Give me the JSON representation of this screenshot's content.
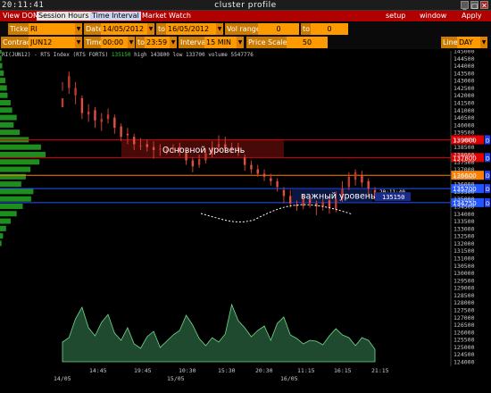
{
  "window": {
    "clock": "20:11:41",
    "title": "cluster profile",
    "buttons": [
      "_",
      "▢",
      "✕"
    ]
  },
  "menu": {
    "tabs": [
      "View DOM",
      "Session Hours",
      "Time Interval",
      "Market Watch"
    ],
    "right": [
      "setup",
      "window",
      "Apply"
    ]
  },
  "controls": {
    "ticker_label": "Ticker",
    "ticker": "RI",
    "date_label": "Date",
    "date_from": "14/05/2012",
    "to1": "to",
    "date_to": "16/05/2012",
    "vol_range_label": "Vol range",
    "vol_min": "0",
    "to2": "to",
    "vol_max": "0",
    "contract_label": "Contract",
    "contract": "JUN12",
    "time_label": "Time",
    "time_from": "00:00",
    "to3": "to",
    "time_to": "23:59",
    "interval_label": "Interval",
    "interval": "15 MIN",
    "price_scale_label": "Price Scale",
    "price_scale": "50",
    "line_label": "Line",
    "line": "DAY"
  },
  "info": {
    "symbol": "RI(JUN12) - RTS Index (RTS FORTS)",
    "last": "135150",
    "stats": "high 143800  low 133700  volume 5547776"
  },
  "chart_data": {
    "type": "candlestick",
    "y_ticks": [
      "145000",
      "144500",
      "144000",
      "143500",
      "143000",
      "142500",
      "142000",
      "141500",
      "141000",
      "140500",
      "140000",
      "139500",
      "139000",
      "138500",
      "138000",
      "137500",
      "137000",
      "136500",
      "136000",
      "135500",
      "135000",
      "134500",
      "134000",
      "133500",
      "133000",
      "132500",
      "132000",
      "131500",
      "131000",
      "130500",
      "130000",
      "129500",
      "129000",
      "128500",
      "128000",
      "127500",
      "127000",
      "126500",
      "126000",
      "125500",
      "125000",
      "124500",
      "124000"
    ],
    "x_ticks": [
      "14:45",
      "19:45",
      "10:30",
      "15:30",
      "20:30",
      "11:15",
      "16:15",
      "21:15"
    ],
    "dates": [
      "14/05",
      "15/05",
      "16/05"
    ],
    "levels": [
      {
        "price": "139000",
        "color": "#e00000"
      },
      {
        "price": "137800",
        "color": "#e00000"
      },
      {
        "price": "136600",
        "color": "#ff8000"
      },
      {
        "price": "135700",
        "color": "#2255ff"
      },
      {
        "price": "134750",
        "color": "#2255ff"
      }
    ],
    "level_tag": "D",
    "annotations": [
      "Основной уровень",
      "важный уровень"
    ],
    "cursor_time": "20:11:40",
    "current_price": "135150",
    "candles": [
      [
        40,
        141200,
        141800,
        142900,
        142300
      ],
      [
        44,
        142500,
        143300,
        143600,
        142100
      ],
      [
        48,
        142000,
        142500,
        142900,
        141400
      ],
      [
        52,
        141800,
        140800,
        142000,
        140400
      ],
      [
        56,
        140700,
        140900,
        141400,
        140200
      ],
      [
        60,
        141000,
        140300,
        141200,
        139800
      ],
      [
        64,
        140200,
        140400,
        140800,
        139600
      ],
      [
        68,
        140400,
        140700,
        141100,
        140100
      ],
      [
        72,
        140500,
        139800,
        140700,
        139400
      ],
      [
        76,
        139900,
        139200,
        140100,
        138900
      ],
      [
        80,
        139400,
        139300,
        139800,
        138700
      ],
      [
        84,
        139200,
        138700,
        139400,
        138300
      ],
      [
        88,
        138600,
        138600,
        139100,
        138300
      ],
      [
        92,
        138700,
        138500,
        139000,
        138200
      ],
      [
        96,
        138500,
        138300,
        138900,
        137700
      ],
      [
        100,
        138400,
        138400,
        138700,
        137900
      ],
      [
        104,
        138300,
        138300,
        138500,
        138000
      ],
      [
        108,
        138300,
        138400,
        138700,
        138100
      ],
      [
        112,
        138500,
        138200,
        138800,
        137900
      ],
      [
        116,
        138100,
        137600,
        138300,
        137300
      ],
      [
        120,
        137600,
        137200,
        137800,
        136800
      ],
      [
        124,
        137300,
        137700,
        138000,
        137100
      ],
      [
        128,
        137600,
        138100,
        138400,
        137400
      ],
      [
        132,
        138000,
        138500,
        138900,
        137800
      ],
      [
        136,
        138500,
        138700,
        139300,
        138200
      ],
      [
        140,
        138700,
        138400,
        139200,
        138200
      ],
      [
        144,
        138400,
        138500,
        138800,
        138100
      ],
      [
        148,
        138500,
        138300,
        138800,
        137900
      ],
      [
        152,
        137800,
        137300,
        138000,
        136900
      ],
      [
        156,
        137300,
        137000,
        137600,
        136700
      ],
      [
        160,
        137000,
        136700,
        137300,
        136500
      ],
      [
        164,
        136700,
        136500,
        137000,
        136200
      ],
      [
        168,
        136400,
        136200,
        136700,
        135900
      ],
      [
        172,
        136200,
        135800,
        136400,
        135500
      ],
      [
        176,
        135600,
        135200,
        135800,
        134700
      ],
      [
        180,
        135200,
        134700,
        135600,
        134400
      ],
      [
        184,
        134600,
        134500,
        134900,
        134200
      ],
      [
        188,
        134500,
        135000,
        135300,
        134300
      ],
      [
        192,
        135000,
        134700,
        135200,
        134400
      ],
      [
        196,
        134700,
        134500,
        134900,
        133900
      ],
      [
        200,
        134500,
        134800,
        135000,
        134200
      ],
      [
        204,
        134900,
        134400,
        135200,
        134000
      ],
      [
        208,
        134300,
        135000,
        135500,
        134100
      ],
      [
        212,
        135000,
        135700,
        136200,
        134800
      ],
      [
        216,
        135800,
        136500,
        136800,
        135600
      ],
      [
        220,
        136300,
        136800,
        137000,
        135900
      ],
      [
        224,
        136600,
        136100,
        136900,
        135800
      ],
      [
        228,
        136200,
        135700,
        136400,
        135200
      ],
      [
        232,
        135600,
        135150,
        135800,
        134900
      ]
    ],
    "volume": [
      [
        40,
        22
      ],
      [
        44,
        27
      ],
      [
        48,
        48
      ],
      [
        52,
        61
      ],
      [
        56,
        38
      ],
      [
        60,
        29
      ],
      [
        64,
        44
      ],
      [
        68,
        53
      ],
      [
        72,
        32
      ],
      [
        76,
        24
      ],
      [
        80,
        38
      ],
      [
        84,
        20
      ],
      [
        88,
        15
      ],
      [
        92,
        28
      ],
      [
        96,
        34
      ],
      [
        100,
        16
      ],
      [
        104,
        23
      ],
      [
        108,
        30
      ],
      [
        112,
        35
      ],
      [
        116,
        52
      ],
      [
        120,
        41
      ],
      [
        124,
        26
      ],
      [
        128,
        18
      ],
      [
        132,
        27
      ],
      [
        136,
        22
      ],
      [
        140,
        31
      ],
      [
        144,
        64
      ],
      [
        148,
        46
      ],
      [
        152,
        38
      ],
      [
        156,
        28
      ],
      [
        160,
        35
      ],
      [
        164,
        40
      ],
      [
        168,
        24
      ],
      [
        172,
        43
      ],
      [
        176,
        50
      ],
      [
        180,
        30
      ],
      [
        184,
        26
      ],
      [
        188,
        20
      ],
      [
        192,
        24
      ],
      [
        196,
        23
      ],
      [
        200,
        19
      ],
      [
        204,
        29
      ],
      [
        208,
        37
      ],
      [
        212,
        30
      ],
      [
        216,
        27
      ],
      [
        220,
        18
      ],
      [
        224,
        27
      ],
      [
        228,
        24
      ],
      [
        232,
        14
      ]
    ],
    "profile": [
      [
        145000,
        2
      ],
      [
        144500,
        2
      ],
      [
        144000,
        3
      ],
      [
        143500,
        5
      ],
      [
        143000,
        7
      ],
      [
        142500,
        9
      ],
      [
        142000,
        10
      ],
      [
        141500,
        14
      ],
      [
        141000,
        16
      ],
      [
        140500,
        22
      ],
      [
        140000,
        18
      ],
      [
        139500,
        26
      ],
      [
        139000,
        38
      ],
      [
        138500,
        54
      ],
      [
        138000,
        60
      ],
      [
        137500,
        52
      ],
      [
        137000,
        40
      ],
      [
        136500,
        34
      ],
      [
        136000,
        28
      ],
      [
        135500,
        44
      ],
      [
        135000,
        41
      ],
      [
        134500,
        30
      ],
      [
        134000,
        22
      ],
      [
        133500,
        14
      ],
      [
        133000,
        8
      ],
      [
        132500,
        4
      ],
      [
        132000,
        2
      ]
    ]
  }
}
